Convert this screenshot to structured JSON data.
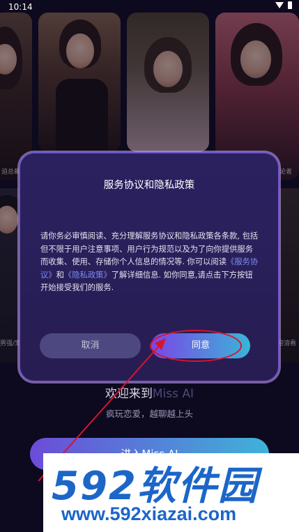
{
  "status_bar": {
    "time": "10:14"
  },
  "gallery": {
    "labels": [
      "迫总裁",
      "论者",
      "男强/宠婚",
      "迎溶看"
    ]
  },
  "dialog": {
    "title": "服务协议和隐私政策",
    "body_before": "请你务必审慎阅读、充分理解服务协议和隐私政策各条款, 包括但不限于用户注意事项、用户行为规范以及为了向你提供服务而收集、使用、存储你个人信息的情况等. 你可以阅读",
    "link_terms": "《服务协议》",
    "conjunction": "和",
    "link_privacy": "《隐私政策》",
    "body_after": "了解详细信息. 如你同意,请点击下方按钮开始接受我们的服务.",
    "cancel_label": "取消",
    "agree_label": "同意"
  },
  "welcome": {
    "title_prefix": "欢迎来到",
    "title_app": "Miss AI",
    "subtitle": "疯玩恋爱，越聊越上头",
    "enter_label": "进入Miss AI"
  },
  "watermark": {
    "logo": "592软件园",
    "url": "www.592xiazai.com"
  },
  "colors": {
    "highlight": "#d3162f",
    "brand_blue": "#1c66c8",
    "accent_purple": "#7b45e6"
  }
}
